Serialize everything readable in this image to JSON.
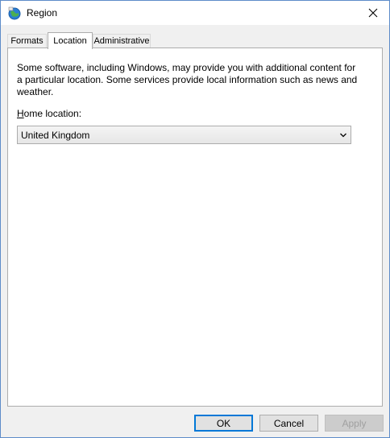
{
  "window": {
    "title": "Region",
    "icon": "globe-region-icon",
    "close_icon": "close-icon"
  },
  "tabs": [
    {
      "label": "Formats",
      "active": false
    },
    {
      "label": "Location",
      "active": true
    },
    {
      "label": "Administrative",
      "active": false
    }
  ],
  "location": {
    "description": "Some software, including Windows, may provide you with additional content for a particular location. Some services provide local information such as news and weather.",
    "home_label_accel": "H",
    "home_label_rest": "ome location:",
    "home_value": "United Kingdom"
  },
  "buttons": {
    "ok": "OK",
    "cancel": "Cancel",
    "apply": "Apply"
  },
  "colors": {
    "window_border": "#5d8cc9",
    "default_button_border": "#0078d7"
  }
}
